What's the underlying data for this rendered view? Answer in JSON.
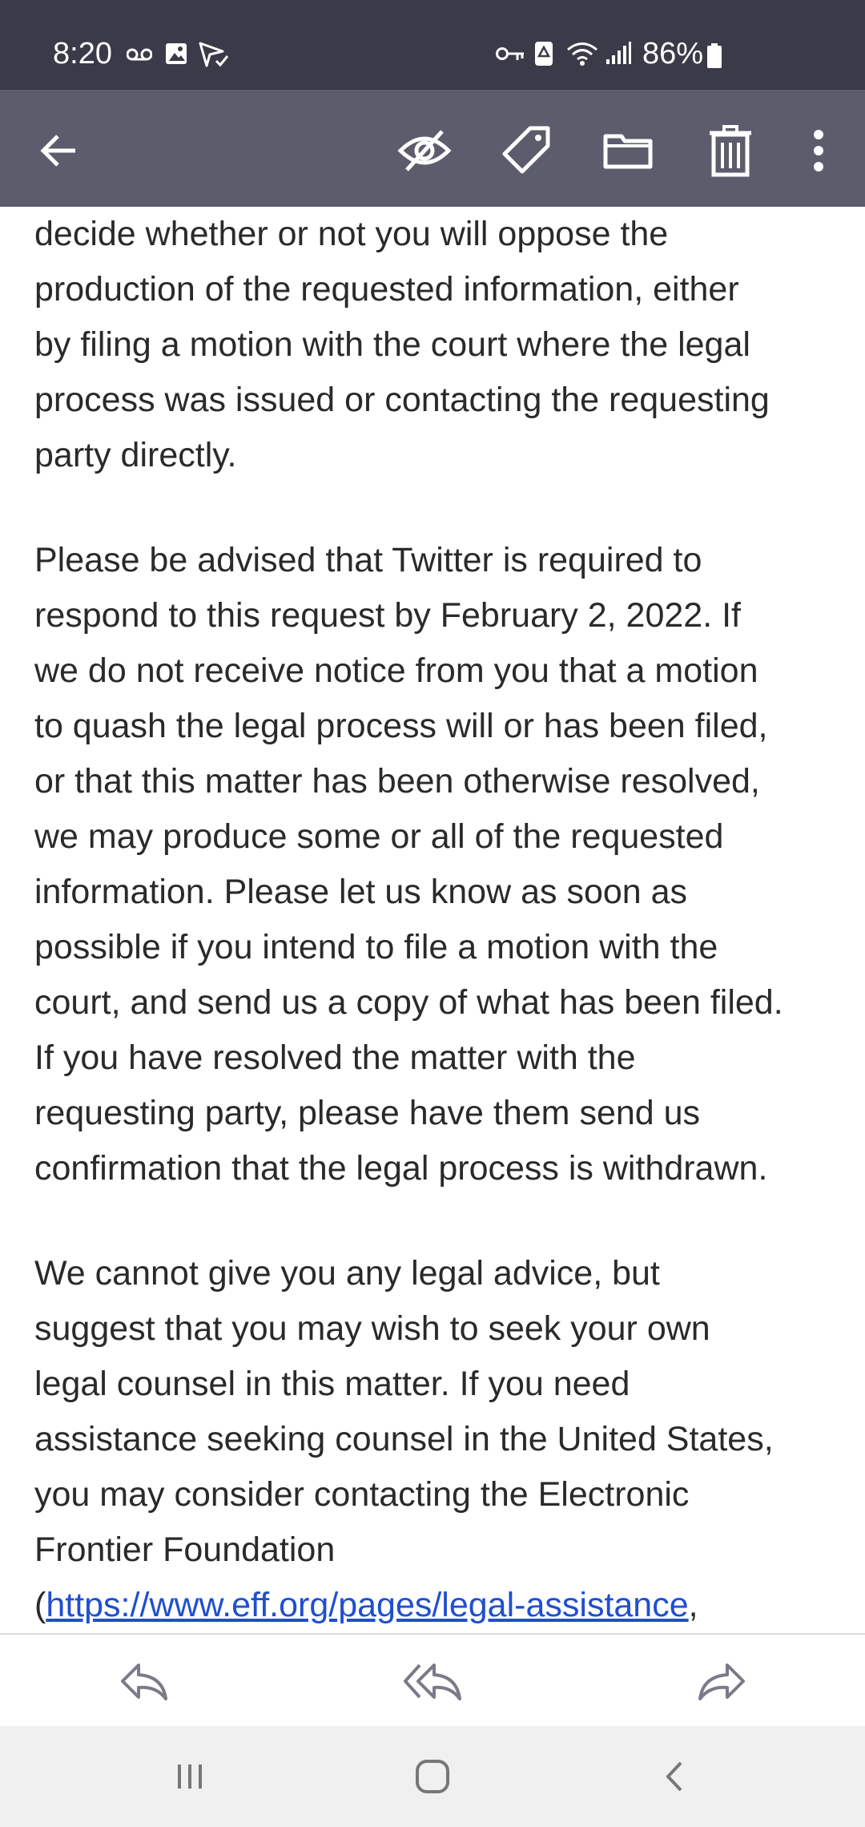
{
  "status_bar": {
    "time": "8:20",
    "battery": "86%",
    "left_icons": [
      "voicemail-icon",
      "gallery-icon",
      "send-check-icon"
    ],
    "right_icons": [
      "vpn-key-icon",
      "recycle-icon",
      "wifi-icon",
      "signal-icon",
      "battery-icon"
    ]
  },
  "toolbar": {
    "icons": [
      "back-arrow-icon",
      "mark-unread-icon",
      "label-tag-icon",
      "folder-icon",
      "trash-icon",
      "more-vertical-icon"
    ],
    "background": "#5c5c6c"
  },
  "message": {
    "paragraph1": [
      "decide whether or not you will oppose the",
      "production of the requested information, either",
      "by filing a motion with the court where the legal",
      "process was issued or contacting the requesting",
      "party directly."
    ],
    "paragraph2": [
      "Please be advised that Twitter is required to",
      "respond to this request by February 2, 2022. If",
      "we do not receive notice from you that a motion",
      "to quash the legal process will or has been filed,",
      "or that this matter has been otherwise resolved,",
      "we may produce some or all of the requested",
      "information. Please let us know as soon as",
      "possible if you intend to file a motion with the",
      "court, and send us a copy of what has been filed.",
      "If you have resolved the matter with the",
      "requesting party, please have them send us",
      "confirmation that the legal process is withdrawn."
    ],
    "paragraph3": [
      "We cannot give you any legal advice, but",
      "suggest that you may wish to seek your own",
      "legal counsel in this matter. If you need",
      "assistance seeking counsel in the United States,",
      "you may consider contacting the Electronic",
      "Frontier Foundation"
    ],
    "link_open_paren": "(",
    "link_text": "https://www.eff.org/pages/legal-assistance",
    "link_trailing": ",",
    "link_color": "#1f4fd0"
  },
  "reply_bar": {
    "icons": [
      "reply-icon",
      "reply-all-icon",
      "forward-icon"
    ]
  },
  "nav_bar": {
    "icons": [
      "recent-apps-icon",
      "home-icon",
      "back-icon"
    ]
  }
}
